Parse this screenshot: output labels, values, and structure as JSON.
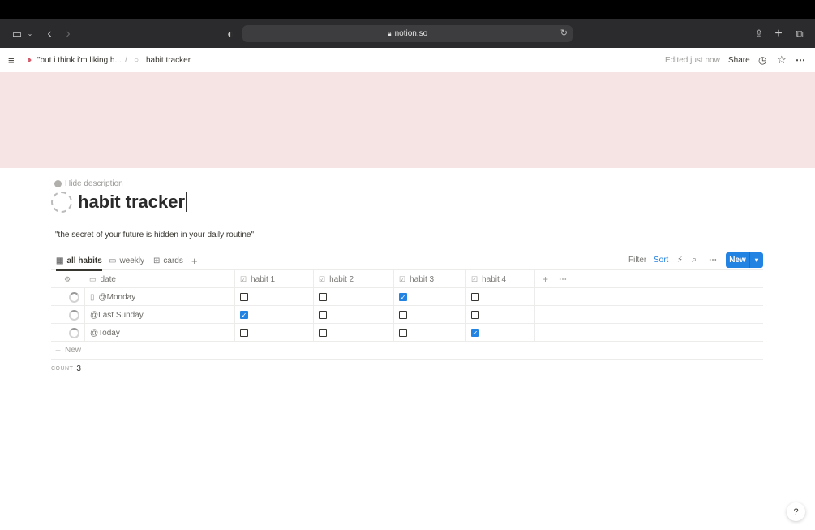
{
  "browser": {
    "url": "notion.so"
  },
  "breadcrumb": {
    "parent": "\"but i think i'm liking h...",
    "separator": "/",
    "current": "habit tracker"
  },
  "topbar": {
    "edited": "Edited just now",
    "share": "Share"
  },
  "page": {
    "hide_description": "Hide description",
    "title": "habit tracker",
    "description": "\"the secret of your future is hidden in your daily routine\""
  },
  "views": [
    {
      "label": "all habits",
      "icon": "table-icon",
      "active": true
    },
    {
      "label": "weekly",
      "icon": "calendar-icon",
      "active": false
    },
    {
      "label": "cards",
      "icon": "gallery-icon",
      "active": false
    }
  ],
  "toolbar": {
    "filter": "Filter",
    "sort": "Sort",
    "new": "New"
  },
  "columns": [
    "date",
    "habit 1",
    "habit 2",
    "habit 3",
    "habit 4"
  ],
  "rows": [
    {
      "date": "@Monday",
      "has_page_icon": true,
      "habits": [
        false,
        false,
        true,
        false
      ]
    },
    {
      "date": "@Last Sunday",
      "has_page_icon": false,
      "habits": [
        true,
        false,
        false,
        false
      ]
    },
    {
      "date": "@Today",
      "has_page_icon": false,
      "habits": [
        false,
        false,
        false,
        true
      ]
    }
  ],
  "add_row": "New",
  "count": {
    "label": "COUNT",
    "value": "3"
  },
  "help": "?",
  "colors": {
    "accent": "#2383e2",
    "cover": "#f6e3e4",
    "safari_bar": "#2b2b2d"
  }
}
